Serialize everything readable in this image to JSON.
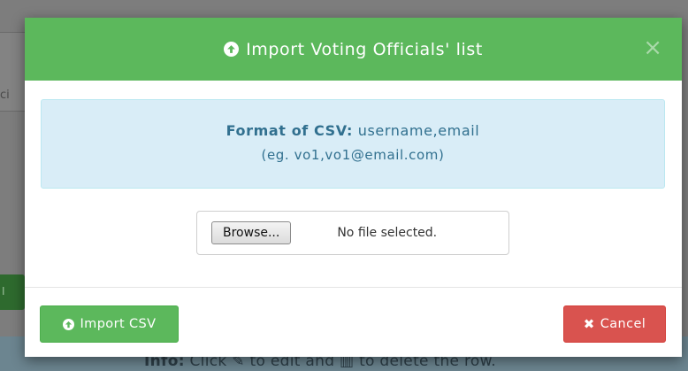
{
  "background": {
    "side_label": "ci",
    "side_button_label": "I",
    "info_prefix": "Info:",
    "info_text_1": " Click ",
    "info_text_2": " to edit and ",
    "info_text_3": " to delete the row."
  },
  "modal": {
    "title": "Import Voting Officials' list",
    "close_symbol": "×",
    "format_label": "Format of CSV:",
    "format_value": "username,email",
    "format_example": "(eg. vo1,vo1@email.com)",
    "file_input": {
      "browse_label": "Browse...",
      "status": "No file selected."
    },
    "import_label": "Import CSV",
    "cancel_label": "Cancel"
  },
  "colors": {
    "success": "#5cb85c",
    "danger": "#d9534f",
    "info_bg": "#d9edf7",
    "info_text": "#31708f"
  }
}
